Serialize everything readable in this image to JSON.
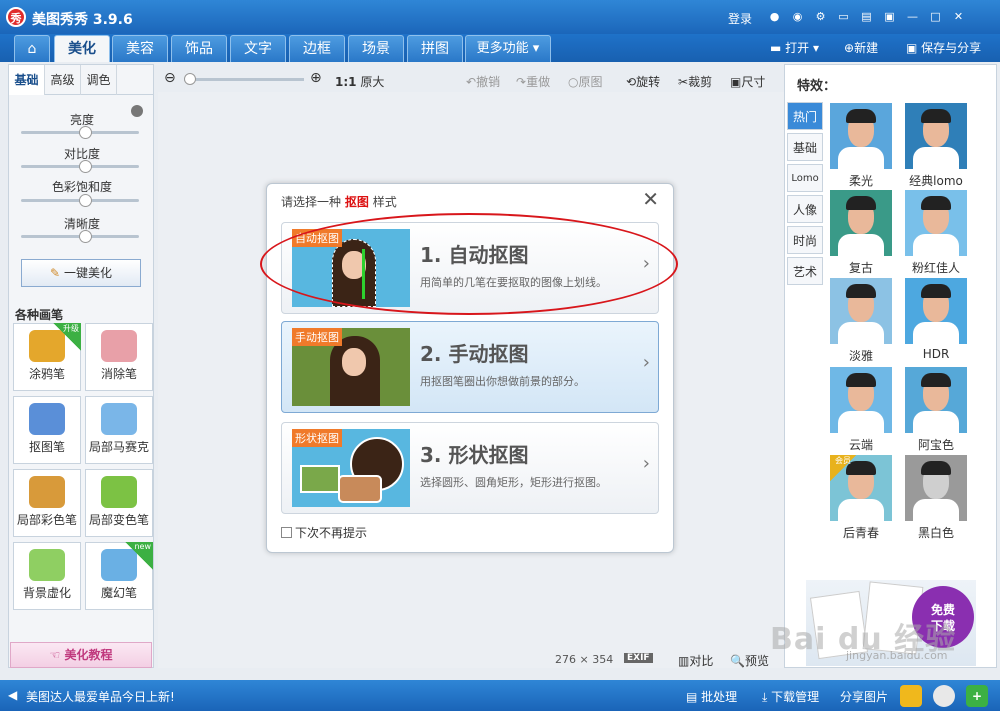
{
  "app": {
    "logo": "秀",
    "title": "美图秀秀 3.9.6",
    "login": "登录"
  },
  "nav": {
    "tabs": [
      "美化",
      "美容",
      "饰品",
      "文字",
      "边框",
      "场景",
      "拼图",
      "更多功能 ▾"
    ],
    "open": "打开",
    "new": "新建",
    "save": "保存与分享"
  },
  "left": {
    "subtabs": [
      "基础",
      "高级",
      "调色"
    ],
    "sliders": [
      {
        "label": "亮度",
        "value": 0.5
      },
      {
        "label": "对比度",
        "value": 0.5
      },
      {
        "label": "色彩饱和度",
        "value": 0.5
      },
      {
        "label": "清晰度",
        "value": 0.5
      }
    ],
    "onekey": "一键美化",
    "brush_header": "各种画笔",
    "brushes": [
      {
        "label": "涂鸦笔",
        "badge": "升级"
      },
      {
        "label": "消除笔"
      },
      {
        "label": "抠图笔"
      },
      {
        "label": "局部马赛克"
      },
      {
        "label": "局部彩色笔"
      },
      {
        "label": "局部变色笔"
      },
      {
        "label": "背景虚化"
      },
      {
        "label": "魔幻笔",
        "badge": "new"
      }
    ],
    "tutorial": "美化教程"
  },
  "toolbar": {
    "ratio": "1:1",
    "orig_size": "原大",
    "undo": "撤销",
    "redo": "重做",
    "original": "原图",
    "rotate": "旋转",
    "crop": "裁剪",
    "size": "尺寸"
  },
  "dialog": {
    "title_prefix": "请选择一种",
    "title_em": "抠图",
    "title_suffix": "样式",
    "options": [
      {
        "tag": "自动抠图",
        "title": "1. 自动抠图",
        "desc": "用简单的几笔在要抠取的图像上划线。"
      },
      {
        "tag": "手动抠图",
        "title": "2. 手动抠图",
        "desc": "用抠图笔圈出你想做前景的部分。"
      },
      {
        "tag": "形状抠图",
        "title": "3. 形状抠图",
        "desc": "选择圆形、圆角矩形，矩形进行抠图。"
      }
    ],
    "dont_show": "下次不再提示"
  },
  "effects": {
    "title": "特效：",
    "categories": [
      "热门",
      "基础",
      "Lomo",
      "人像",
      "时尚",
      "艺术"
    ],
    "items": [
      {
        "name": "柔光",
        "bg": "#5aa6dc"
      },
      {
        "name": "经典lomo",
        "bg": "#2f7fb8"
      },
      {
        "name": "复古",
        "bg": "#3a9a88"
      },
      {
        "name": "粉红佳人",
        "bg": "#79c0ea"
      },
      {
        "name": "淡雅",
        "bg": "#8cc2e4"
      },
      {
        "name": "HDR",
        "bg": "#4da8e0"
      },
      {
        "name": "云端",
        "bg": "#6fb8e6"
      },
      {
        "name": "阿宝色",
        "bg": "#56a8d8"
      },
      {
        "name": "后青春",
        "bg": "#7cc4d6",
        "badge": "会员"
      },
      {
        "name": "黑白色",
        "bg": "#9a9a9a"
      }
    ]
  },
  "ad": {
    "btn_line1": "免费",
    "btn_line2": "下载"
  },
  "watermark": {
    "text": "Bai du 经验",
    "url": "jingyan.baidu.com"
  },
  "bottom": {
    "width": "276",
    "height": "354",
    "exif": "EXIF",
    "compare": "对比",
    "preview": "预览"
  },
  "status": {
    "message": "美图达人最爱单品今日上新!",
    "batch": "批处理",
    "download": "下载管理",
    "share": "分享图片"
  }
}
